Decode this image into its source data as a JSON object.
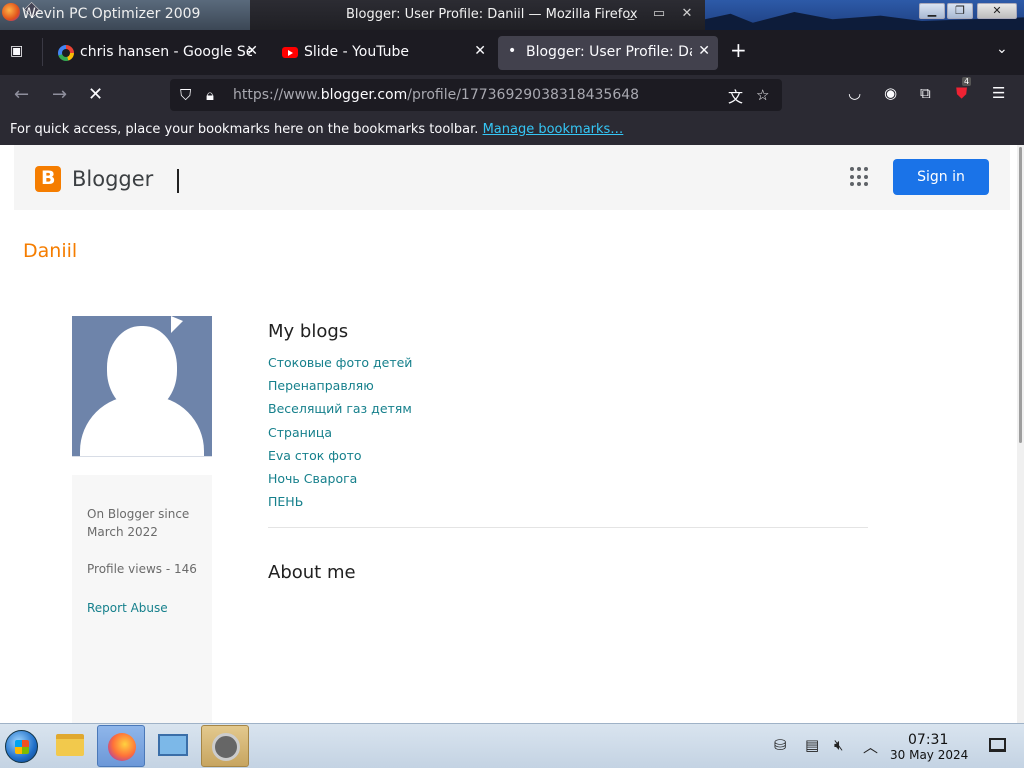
{
  "window": {
    "left_title": "Wevin PC Optimizer 2009",
    "center_title": "Blogger: User Profile: Daniil — Mozilla Firefox"
  },
  "tabs": [
    {
      "label": "chris hansen - Google Se",
      "active": false
    },
    {
      "label": "Slide - YouTube",
      "active": false
    },
    {
      "label": "Blogger: User Profile: Dai",
      "active": true
    }
  ],
  "navbar": {
    "url_prefix": "https://www.",
    "url_domain": "blogger.com",
    "url_path": "/profile/17736929038318435648",
    "extension_badge": "4"
  },
  "bookmarks_bar": {
    "message": "For quick access, place your bookmarks here on the bookmarks toolbar.",
    "link": "Manage bookmarks…"
  },
  "blogger": {
    "brand": "Blogger",
    "sign_in": "Sign in",
    "profile_name": "Daniil",
    "on_blogger_since": "On Blogger since March 2022",
    "profile_views": "Profile views - 146",
    "report_abuse": "Report Abuse",
    "my_blogs_heading": "My blogs",
    "blogs": [
      "Стоковые фото детей",
      "Перенаправляю",
      "Веселящий газ детям",
      "Страница",
      "Eva сток фото",
      "Ночь Сварога",
      "ПЕНЬ"
    ],
    "about_me_heading": "About me"
  },
  "taskbar": {
    "time": "07:31",
    "date": "30 May 2024"
  }
}
